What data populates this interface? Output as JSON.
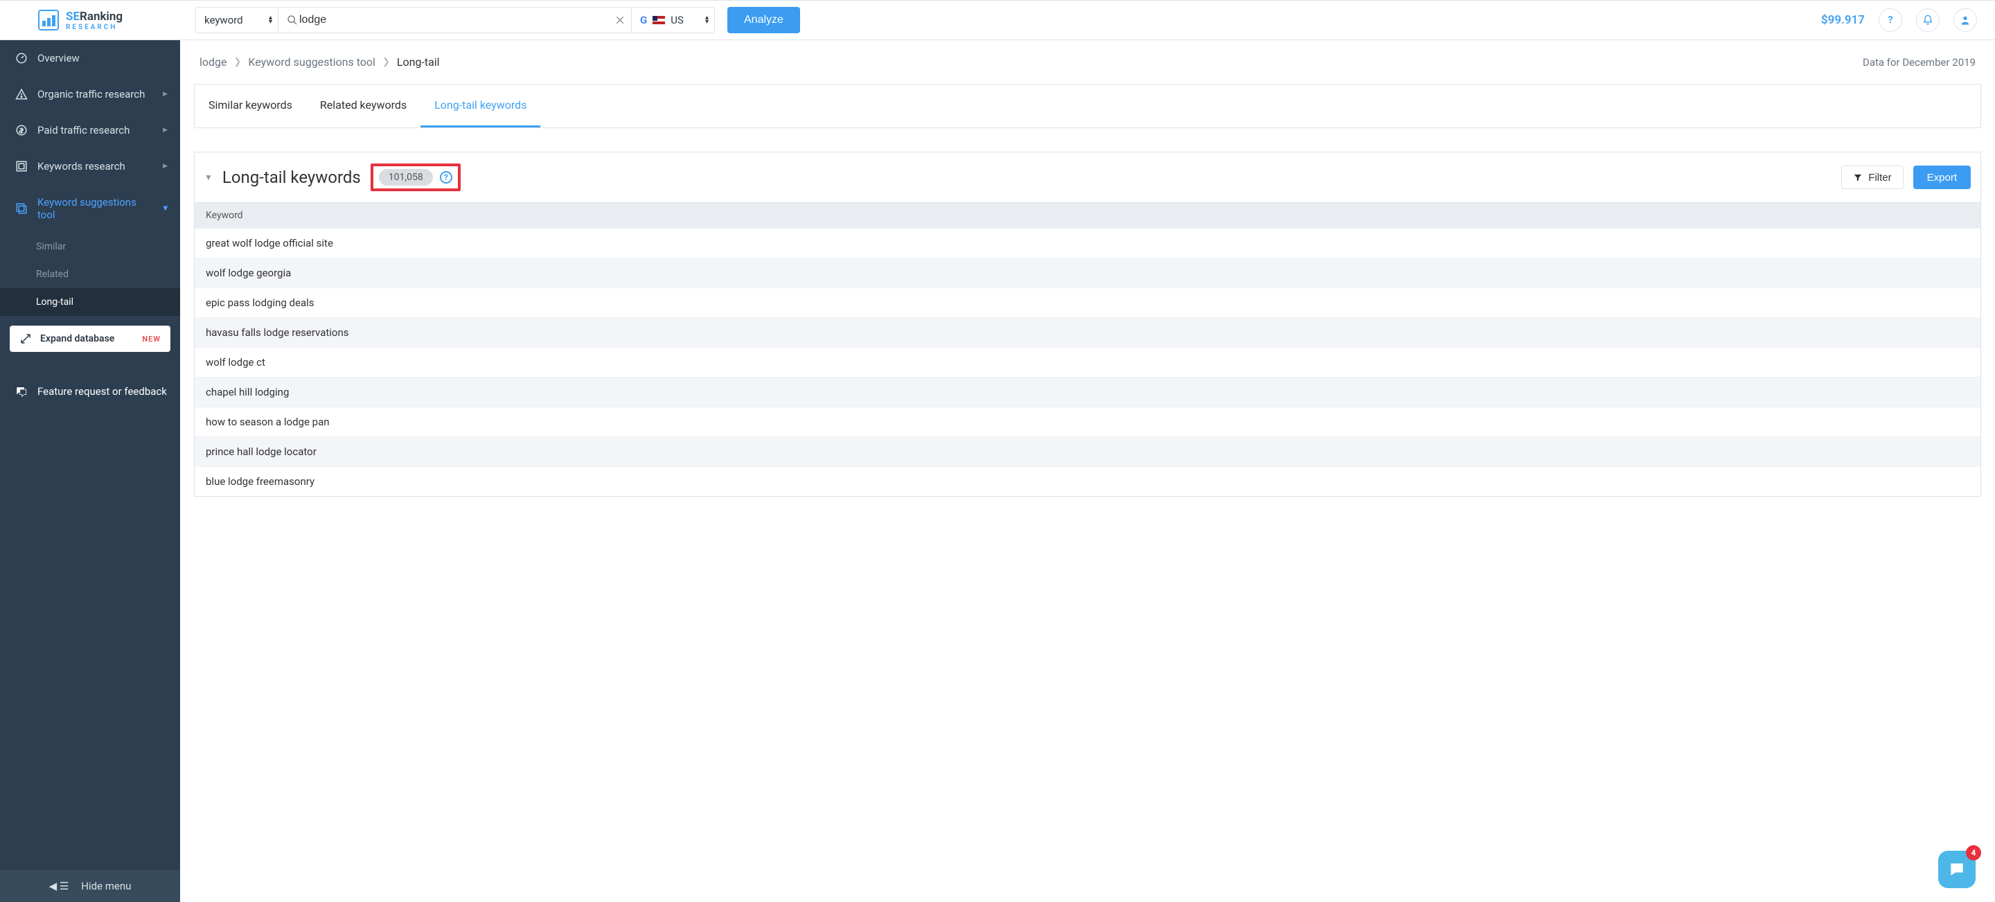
{
  "header": {
    "logo_small": "SE",
    "logo_main": "Ranking",
    "logo_sub": "RESEARCH",
    "type_select": "keyword",
    "search_value": "lodge",
    "country_code": "US",
    "analyze": "Analyze",
    "balance": "$99.917"
  },
  "sidebar": {
    "items": [
      {
        "label": "Overview"
      },
      {
        "label": "Organic traffic research"
      },
      {
        "label": "Paid traffic research"
      },
      {
        "label": "Keywords research"
      },
      {
        "label": "Keyword suggestions tool"
      }
    ],
    "subitems": [
      {
        "label": "Similar"
      },
      {
        "label": "Related"
      },
      {
        "label": "Long-tail"
      }
    ],
    "expand": "Expand database",
    "expand_badge": "NEW",
    "feedback": "Feature request or feedback",
    "hide": "Hide menu"
  },
  "breadcrumb": {
    "a": "lodge",
    "b": "Keyword suggestions tool",
    "c": "Long-tail",
    "date": "Data for December 2019"
  },
  "tabs": {
    "a": "Similar keywords",
    "b": "Related keywords",
    "c": "Long-tail keywords"
  },
  "panel": {
    "title": "Long-tail keywords",
    "count": "101,058",
    "filter": "Filter",
    "export": "Export",
    "col_keyword": "Keyword"
  },
  "rows": [
    "great wolf lodge official site",
    "wolf lodge georgia",
    "epic pass lodging deals",
    "havasu falls lodge reservations",
    "wolf lodge ct",
    "chapel hill lodging",
    "how to season a lodge pan",
    "prince hall lodge locator",
    "blue lodge freemasonry"
  ],
  "chat_badge": "4"
}
